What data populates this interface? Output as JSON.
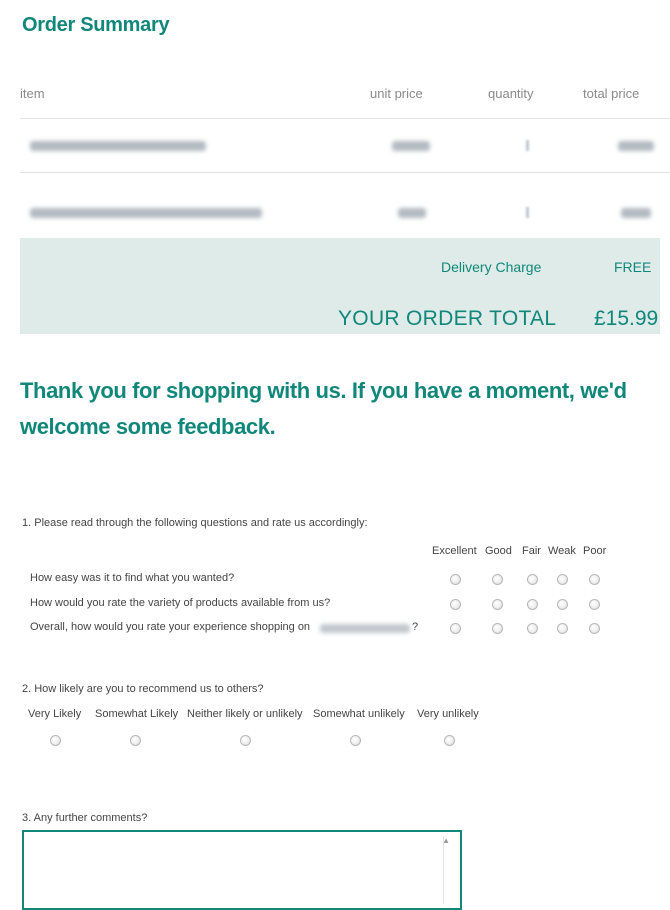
{
  "order_summary": {
    "title": "Order Summary",
    "columns": {
      "item": "item",
      "unit_price": "unit price",
      "quantity": "quantity",
      "total_price": "total price"
    },
    "delivery": {
      "label": "Delivery Charge",
      "value": "FREE"
    },
    "total": {
      "label": "YOUR ORDER TOTAL",
      "value": "£15.99"
    }
  },
  "feedback": {
    "heading": "Thank you for shopping with us. If you have a moment, we'd welcome some feedback.",
    "q1": {
      "text": "1. Please read through the following questions and rate us accordingly:",
      "scale": [
        "Excellent",
        "Good",
        "Fair",
        "Weak",
        "Poor"
      ],
      "questions": [
        "How easy was it to find what you wanted?",
        "How would you rate the variety of products available from us?",
        "Overall, how would you rate your experience shopping on"
      ],
      "q3_suffix": "?"
    },
    "q2": {
      "text": "2. How likely are you to recommend us to others?",
      "options": [
        "Very Likely",
        "Somewhat Likely",
        "Neither likely or unlikely",
        "Somewhat unlikely",
        "Very unlikely"
      ]
    },
    "q3": {
      "text": "3. Any further comments?"
    }
  }
}
